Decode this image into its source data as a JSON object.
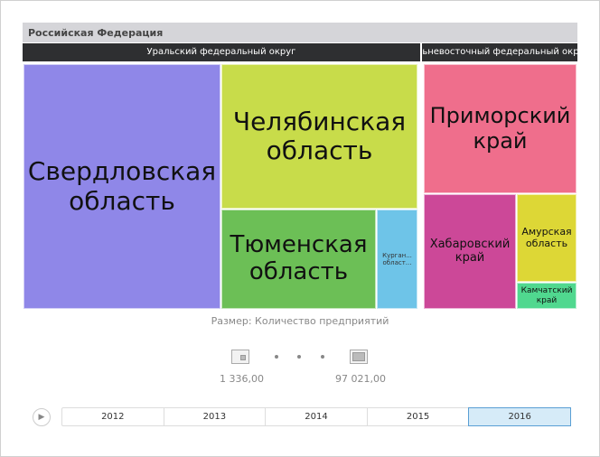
{
  "header": {
    "title": "Российская Федерация"
  },
  "groups": [
    {
      "label": "Уральский федеральный округ"
    },
    {
      "label": "Дальневосточный федеральный округ"
    }
  ],
  "tiles": [
    {
      "label": "Свердловская область",
      "color": "#8f87e8"
    },
    {
      "label": "Челябинская область",
      "color": "#c8dc4a"
    },
    {
      "label": "Тюменская область",
      "color": "#6cbf56"
    },
    {
      "label": "Курган... област...",
      "color": "#6ec4e8"
    },
    {
      "label": "Приморский край",
      "color": "#ef6e8c"
    },
    {
      "label": "Хабаровский край",
      "color": "#cc4898"
    },
    {
      "label": "Амурская область",
      "color": "#ddd736"
    },
    {
      "label": "Камчатский край",
      "color": "#50d88f"
    }
  ],
  "legend": {
    "title": "Размер: Количество предприятий",
    "min": "1 336,00",
    "max": "97 021,00"
  },
  "timeline": {
    "years": [
      "2012",
      "2013",
      "2014",
      "2015",
      "2016"
    ],
    "selected": "2016"
  }
}
